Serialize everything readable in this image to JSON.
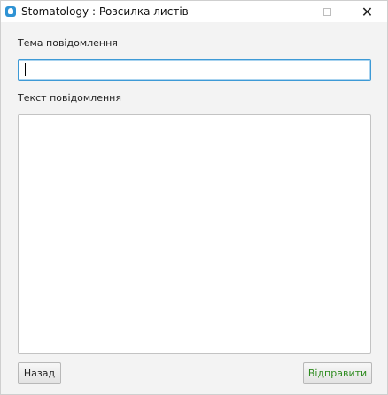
{
  "window": {
    "title": "Stomatology : Розсилка листів",
    "icon": "tooth-icon",
    "accent_color": "#2f93d4"
  },
  "form": {
    "subject_label": "Тема повідомлення",
    "subject_value": "",
    "body_label": "Текст повідомлення",
    "body_value": ""
  },
  "buttons": {
    "back_label": "Назад",
    "send_label": "Відправити",
    "send_color": "#2e8b1f"
  }
}
